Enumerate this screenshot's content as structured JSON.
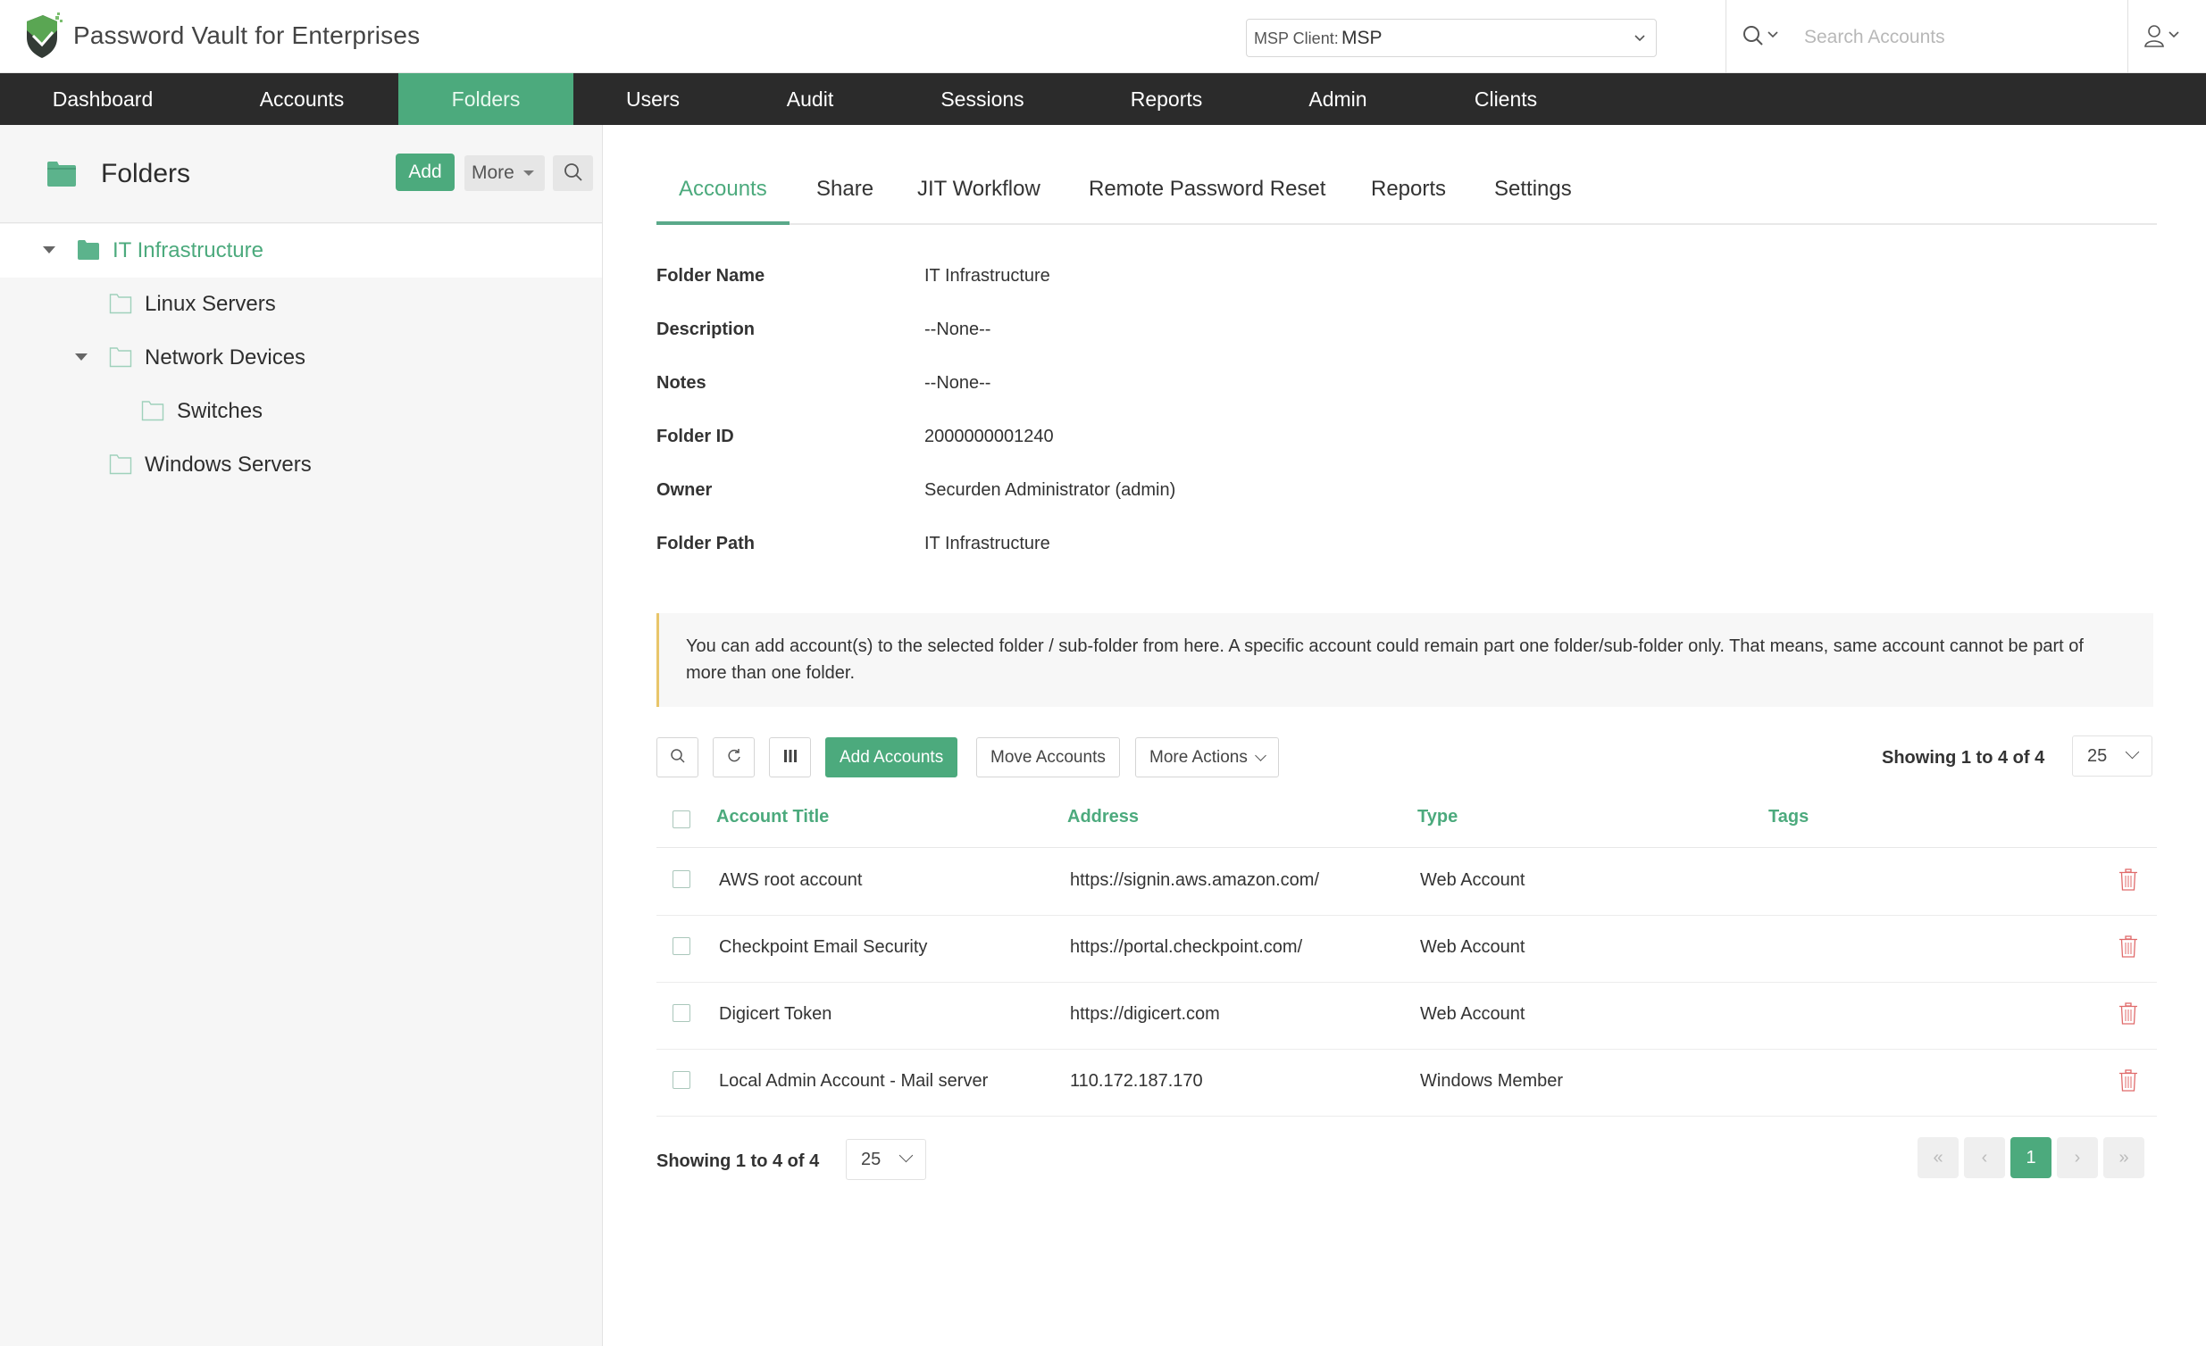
{
  "header": {
    "app_title": "Password Vault for Enterprises",
    "msp_client_label": "MSP Client:",
    "msp_client_value": "MSP",
    "search_placeholder": "Search Accounts"
  },
  "nav": {
    "items": [
      {
        "label": "Dashboard",
        "active": false
      },
      {
        "label": "Accounts",
        "active": false
      },
      {
        "label": "Folders",
        "active": true
      },
      {
        "label": "Users",
        "active": false
      },
      {
        "label": "Audit",
        "active": false
      },
      {
        "label": "Sessions",
        "active": false
      },
      {
        "label": "Reports",
        "active": false
      },
      {
        "label": "Admin",
        "active": false
      },
      {
        "label": "Clients",
        "active": false
      }
    ]
  },
  "sidebar": {
    "title": "Folders",
    "add_label": "Add",
    "more_label": "More",
    "tree": [
      {
        "label": "IT Infrastructure",
        "level": 0,
        "expanded": true,
        "selected": true
      },
      {
        "label": "Linux Servers",
        "level": 1,
        "expanded": null,
        "selected": false
      },
      {
        "label": "Network Devices",
        "level": 1,
        "expanded": true,
        "selected": false
      },
      {
        "label": "Switches",
        "level": 2,
        "expanded": null,
        "selected": false
      },
      {
        "label": "Windows Servers",
        "level": 1,
        "expanded": null,
        "selected": false
      }
    ]
  },
  "tabs": [
    {
      "label": "Accounts",
      "active": true
    },
    {
      "label": "Share",
      "active": false
    },
    {
      "label": "JIT Workflow",
      "active": false
    },
    {
      "label": "Remote Password Reset",
      "active": false
    },
    {
      "label": "Reports",
      "active": false
    },
    {
      "label": "Settings",
      "active": false
    }
  ],
  "details": [
    {
      "label": "Folder Name",
      "value": "IT Infrastructure"
    },
    {
      "label": "Description",
      "value": "--None--"
    },
    {
      "label": "Notes",
      "value": "--None--"
    },
    {
      "label": "Folder ID",
      "value": "2000000001240"
    },
    {
      "label": "Owner",
      "value": "Securden Administrator (admin)"
    },
    {
      "label": "Folder Path",
      "value": "IT Infrastructure"
    }
  ],
  "info_message": "You can add account(s) to the selected folder / sub-folder from here. A specific account could remain part one folder/sub-folder only. That means, same account cannot be part of more than one folder.",
  "toolbar": {
    "add_accounts_label": "Add Accounts",
    "move_accounts_label": "Move Accounts",
    "more_actions_label": "More Actions",
    "showing_text": "Showing 1 to 4 of 4",
    "page_size": "25"
  },
  "table": {
    "columns": [
      "Account Title",
      "Address",
      "Type",
      "Tags"
    ],
    "rows": [
      {
        "title": "AWS root account",
        "address": "https://signin.aws.amazon.com/",
        "type": "Web Account",
        "tags": ""
      },
      {
        "title": "Checkpoint Email Security",
        "address": "https://portal.checkpoint.com/",
        "type": "Web Account",
        "tags": ""
      },
      {
        "title": "Digicert Token",
        "address": "https://digicert.com",
        "type": "Web Account",
        "tags": ""
      },
      {
        "title": "Local Admin Account - Mail server",
        "address": "110.172.187.170",
        "type": "Windows Member",
        "tags": ""
      }
    ]
  },
  "footer": {
    "showing_text": "Showing 1 to 4 of 4",
    "page_size": "25",
    "first_label": "«",
    "prev_label": "‹",
    "current_page": "1",
    "next_label": "›",
    "last_label": "»"
  },
  "colors": {
    "accent": "#4caa7d",
    "nav_bg": "#2b2b2b",
    "delete": "#e06b6b",
    "info_border": "#e8c56a"
  }
}
